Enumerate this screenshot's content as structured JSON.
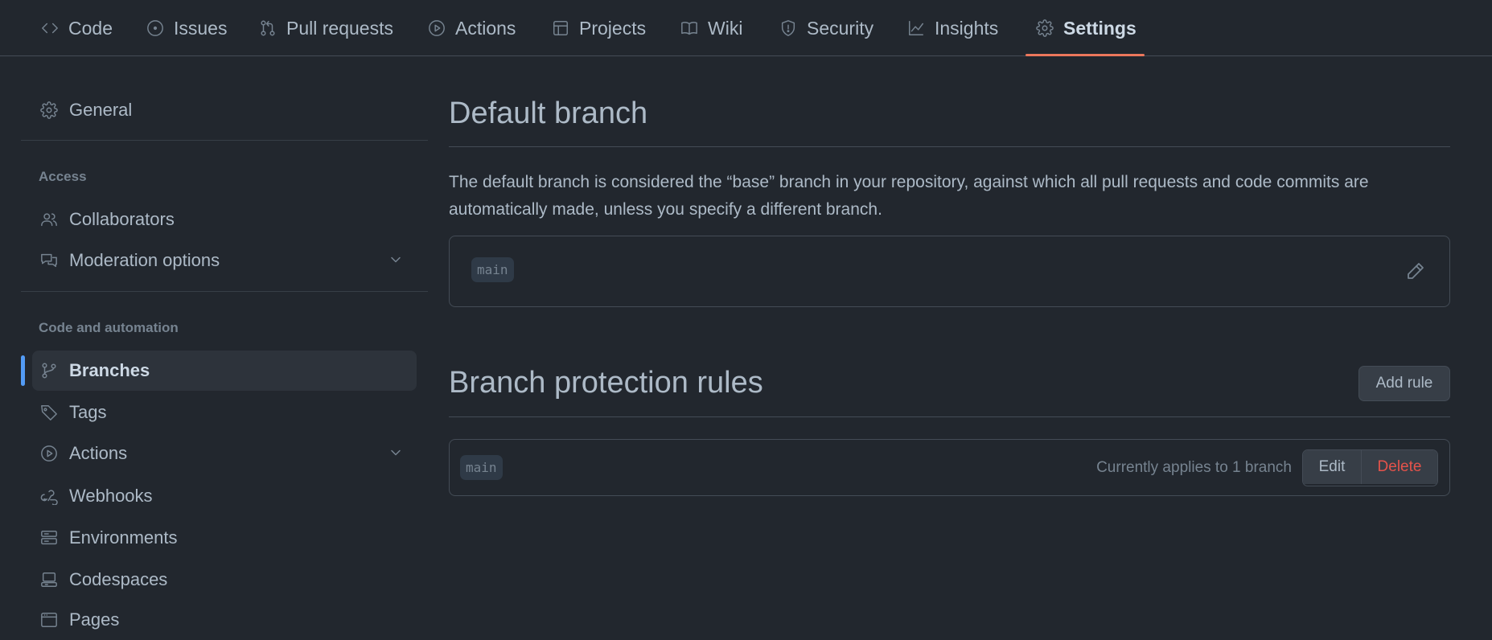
{
  "tabs": [
    {
      "label": "Code",
      "icon": "code-icon"
    },
    {
      "label": "Issues",
      "icon": "issue-opened-icon"
    },
    {
      "label": "Pull requests",
      "icon": "git-pull-request-icon"
    },
    {
      "label": "Actions",
      "icon": "play-icon"
    },
    {
      "label": "Projects",
      "icon": "table-icon"
    },
    {
      "label": "Wiki",
      "icon": "book-icon"
    },
    {
      "label": "Security",
      "icon": "shield-icon"
    },
    {
      "label": "Insights",
      "icon": "graph-icon"
    },
    {
      "label": "Settings",
      "icon": "gear-icon",
      "active": true
    }
  ],
  "sidebar": {
    "general": {
      "label": "General",
      "icon": "gear-icon"
    },
    "access_heading": "Access",
    "collaborators": {
      "label": "Collaborators",
      "icon": "people-icon"
    },
    "moderation": {
      "label": "Moderation options",
      "icon": "comment-discussion-icon"
    },
    "code_heading": "Code and automation",
    "branches": {
      "label": "Branches",
      "icon": "git-branch-icon",
      "active": true
    },
    "tags": {
      "label": "Tags",
      "icon": "tag-icon"
    },
    "actions": {
      "label": "Actions",
      "icon": "play-icon"
    },
    "webhooks": {
      "label": "Webhooks",
      "icon": "webhook-icon"
    },
    "environments": {
      "label": "Environments",
      "icon": "server-icon"
    },
    "codespaces": {
      "label": "Codespaces",
      "icon": "codespaces-icon"
    },
    "pages": {
      "label": "Pages",
      "icon": "browser-icon"
    }
  },
  "default_branch": {
    "title": "Default branch",
    "description": "The default branch is considered the “base” branch in your repository, against which all pull requests and code commits are automatically made, unless you specify a different branch.",
    "branch": "main"
  },
  "protection": {
    "title": "Branch protection rules",
    "add_rule_label": "Add rule",
    "rules": [
      {
        "branch": "main",
        "applies": "Currently applies to 1 branch",
        "edit_label": "Edit",
        "delete_label": "Delete"
      }
    ]
  },
  "colors": {
    "background": "#22272e",
    "accent_underline": "#ec775c",
    "active_marker": "#539bf5",
    "danger": "#e5534b"
  }
}
